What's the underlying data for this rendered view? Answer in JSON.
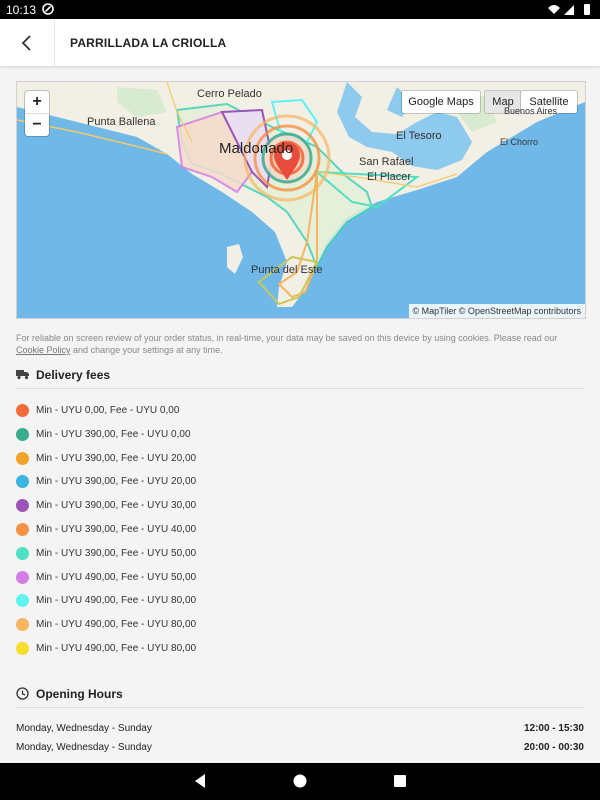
{
  "status_bar": {
    "time": "10:13"
  },
  "header": {
    "title": "PARRILLADA LA CRIOLLA"
  },
  "map": {
    "google_maps_label": "Google Maps",
    "map_label": "Map",
    "satellite_label": "Satellite",
    "zoom_in": "+",
    "zoom_out": "−",
    "places": [
      "Cerro Pelado",
      "Punta Ballena",
      "Maldonado",
      "El Tesoro",
      "San Rafael",
      "El Placer",
      "El Chorro",
      "Punta del Este",
      "Buenos Aires"
    ],
    "attribution": "© MapTiler © OpenStreetMap contributors"
  },
  "cookie": {
    "text": "For reliable on screen review of your order status, in real-time, your data may be saved on this device by using cookies. Please read our",
    "link": "Cookie Policy",
    "text2": "and change your settings at any time."
  },
  "delivery": {
    "heading": "Delivery fees",
    "fees": [
      {
        "label": "Min - UYU 0,00, Fee - UYU 0,00",
        "color": "#f26b3a"
      },
      {
        "label": "Min - UYU 390,00, Fee - UYU 0,00",
        "color": "#3bab8e"
      },
      {
        "label": "Min - UYU 390,00, Fee - UYU 20,00",
        "color": "#f0a52a"
      },
      {
        "label": "Min - UYU 390,00, Fee - UYU 20,00",
        "color": "#3cb4e0"
      },
      {
        "label": "Min - UYU 390,00, Fee - UYU 30,00",
        "color": "#9b55b6"
      },
      {
        "label": "Min - UYU 390,00, Fee - UYU 40,00",
        "color": "#f39245"
      },
      {
        "label": "Min - UYU 390,00, Fee - UYU 50,00",
        "color": "#4fe0c2"
      },
      {
        "label": "Min - UYU 490,00, Fee - UYU 50,00",
        "color": "#d47ee8"
      },
      {
        "label": "Min - UYU 490,00, Fee - UYU 80,00",
        "color": "#5ef2f0"
      },
      {
        "label": "Min - UYU 490,00, Fee - UYU 80,00",
        "color": "#f6b55e"
      },
      {
        "label": "Min - UYU 490,00, Fee - UYU 80,00",
        "color": "#f7dc2a"
      }
    ]
  },
  "opening": {
    "heading": "Opening Hours",
    "rows": [
      {
        "days": "Monday, Wednesday - Sunday",
        "time": "12:00 - 15:30"
      },
      {
        "days": "Monday, Wednesday - Sunday",
        "time": "20:00 - 00:30"
      }
    ]
  }
}
